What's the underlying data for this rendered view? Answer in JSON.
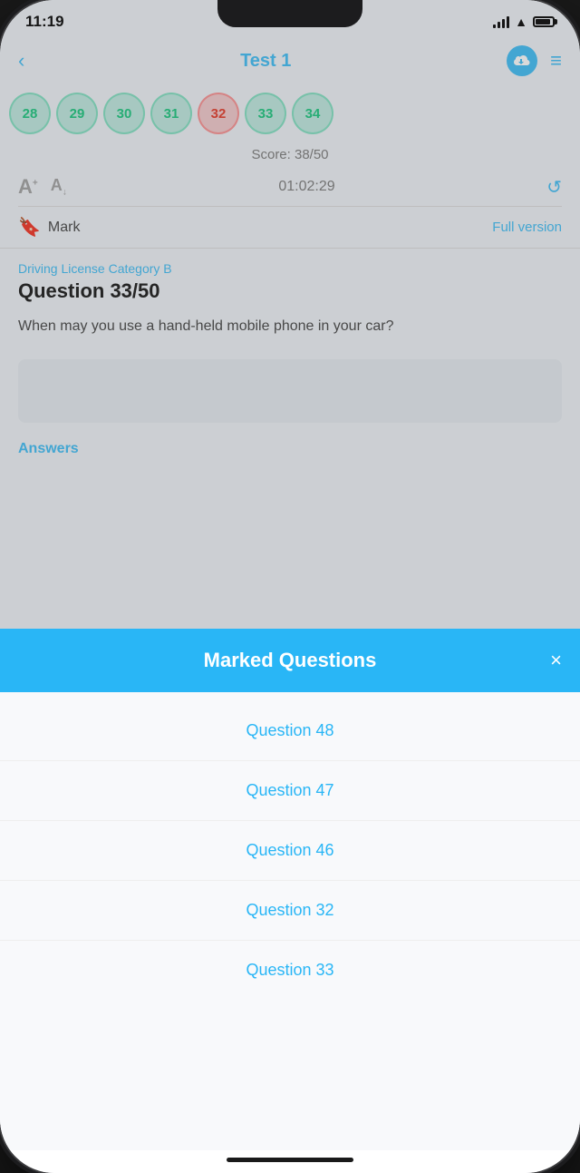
{
  "status_bar": {
    "time": "11:19",
    "signal_label": "signal",
    "wifi_label": "wifi",
    "battery_label": "battery"
  },
  "header": {
    "back_label": "‹",
    "title": "Test 1",
    "cloud_icon": "☁",
    "filter_icon": "⊟"
  },
  "question_numbers": [
    {
      "number": "28",
      "state": "correct"
    },
    {
      "number": "29",
      "state": "correct"
    },
    {
      "number": "30",
      "state": "correct"
    },
    {
      "number": "31",
      "state": "correct"
    },
    {
      "number": "32",
      "state": "wrong"
    },
    {
      "number": "33",
      "state": "correct"
    },
    {
      "number": "34",
      "state": "correct"
    }
  ],
  "score": {
    "label": "Score: 38/50"
  },
  "font_row": {
    "timer": "01:02:29"
  },
  "mark_row": {
    "bookmark_label": "Mark",
    "full_version_label": "Full version"
  },
  "question": {
    "category": "Driving License Category B",
    "number_label": "Question 33/50",
    "text": "When may you use a hand-held mobile phone in your car?"
  },
  "answers": {
    "label": "Answers"
  },
  "modal": {
    "title": "Marked Questions",
    "close_label": "×",
    "items": [
      {
        "label": "Question 48"
      },
      {
        "label": "Question 47"
      },
      {
        "label": "Question 46"
      },
      {
        "label": "Question 32"
      },
      {
        "label": "Question 33"
      }
    ]
  }
}
